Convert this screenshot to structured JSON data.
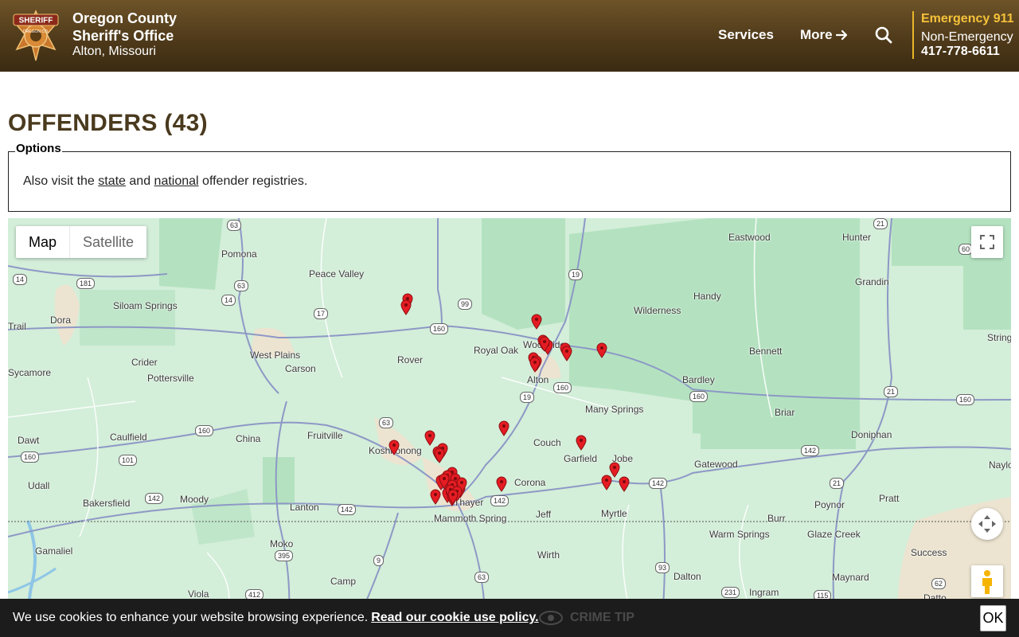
{
  "header": {
    "brand_line1": "Oregon County",
    "brand_line2": "Sheriff's Office",
    "location": "Alton, Missouri",
    "nav": {
      "services": "Services",
      "more": "More"
    },
    "emergency_label": "Emergency 911",
    "non_emergency_label": "Non-Emergency",
    "non_emergency_phone": "417-778-6611",
    "badge_text": "SHERIFF",
    "badge_subtext": "OREGON CO.",
    "accent_color": "#f5c23a"
  },
  "page": {
    "title": "OFFENDERS (43)"
  },
  "options": {
    "legend": "Options",
    "text_before": "Also visit the ",
    "link_state": "state",
    "text_mid": " and ",
    "link_national": "national",
    "text_after": " offender registries."
  },
  "map": {
    "type_buttons": {
      "map": "Map",
      "satellite": "Satellite"
    },
    "selected_type": "Map",
    "controls": [
      "fullscreen-icon",
      "camera-control-icon",
      "pegman-icon"
    ],
    "marker_color": "#e51c23",
    "towns": [
      "Pomona",
      "Peace Valley",
      "Eastwood",
      "Hunter",
      "Grandin",
      "Handy",
      "Wilderness",
      "Dora",
      "Siloam Springs",
      "Trail",
      "West Plains",
      "Crider",
      "Pottersville",
      "Sycamore",
      "Carson",
      "Rover",
      "Royal Oak",
      "Woodside",
      "Alton",
      "Bennett",
      "Bardley",
      "Many Springs",
      "Briar",
      "Doniphan",
      "Dawt",
      "Caulfield",
      "China",
      "Fruitville",
      "Koshkonong",
      "Couch",
      "Garfield",
      "Jobe",
      "Gatewood",
      "Naylor",
      "Udall",
      "Bakersfield",
      "Moody",
      "Lanton",
      "Corona",
      "Thayer",
      "Mammoth Spring",
      "Jeff",
      "Myrtle",
      "Poynor",
      "Pratt",
      "Burr",
      "Warm Springs",
      "Glaze Creek",
      "Gamaliel",
      "Moko",
      "Wirth",
      "Camp",
      "Viola",
      "Dalton",
      "Ingram",
      "Maynard",
      "Success",
      "Datto",
      "String"
    ],
    "shields": [
      "63",
      "63",
      "14",
      "181",
      "14",
      "17",
      "160",
      "99",
      "19",
      "19",
      "160",
      "63",
      "160",
      "160",
      "101",
      "142",
      "142",
      "142",
      "142",
      "142",
      "21",
      "21",
      "21",
      "160",
      "160",
      "9",
      "63",
      "395",
      "93",
      "231",
      "115",
      "62",
      "60",
      "412"
    ]
  },
  "cookie": {
    "text": "We use cookies to enhance your website browsing experience.",
    "link": "Read our cookie use policy.",
    "ok": "OK",
    "behind_label": "CRIME TIP"
  }
}
